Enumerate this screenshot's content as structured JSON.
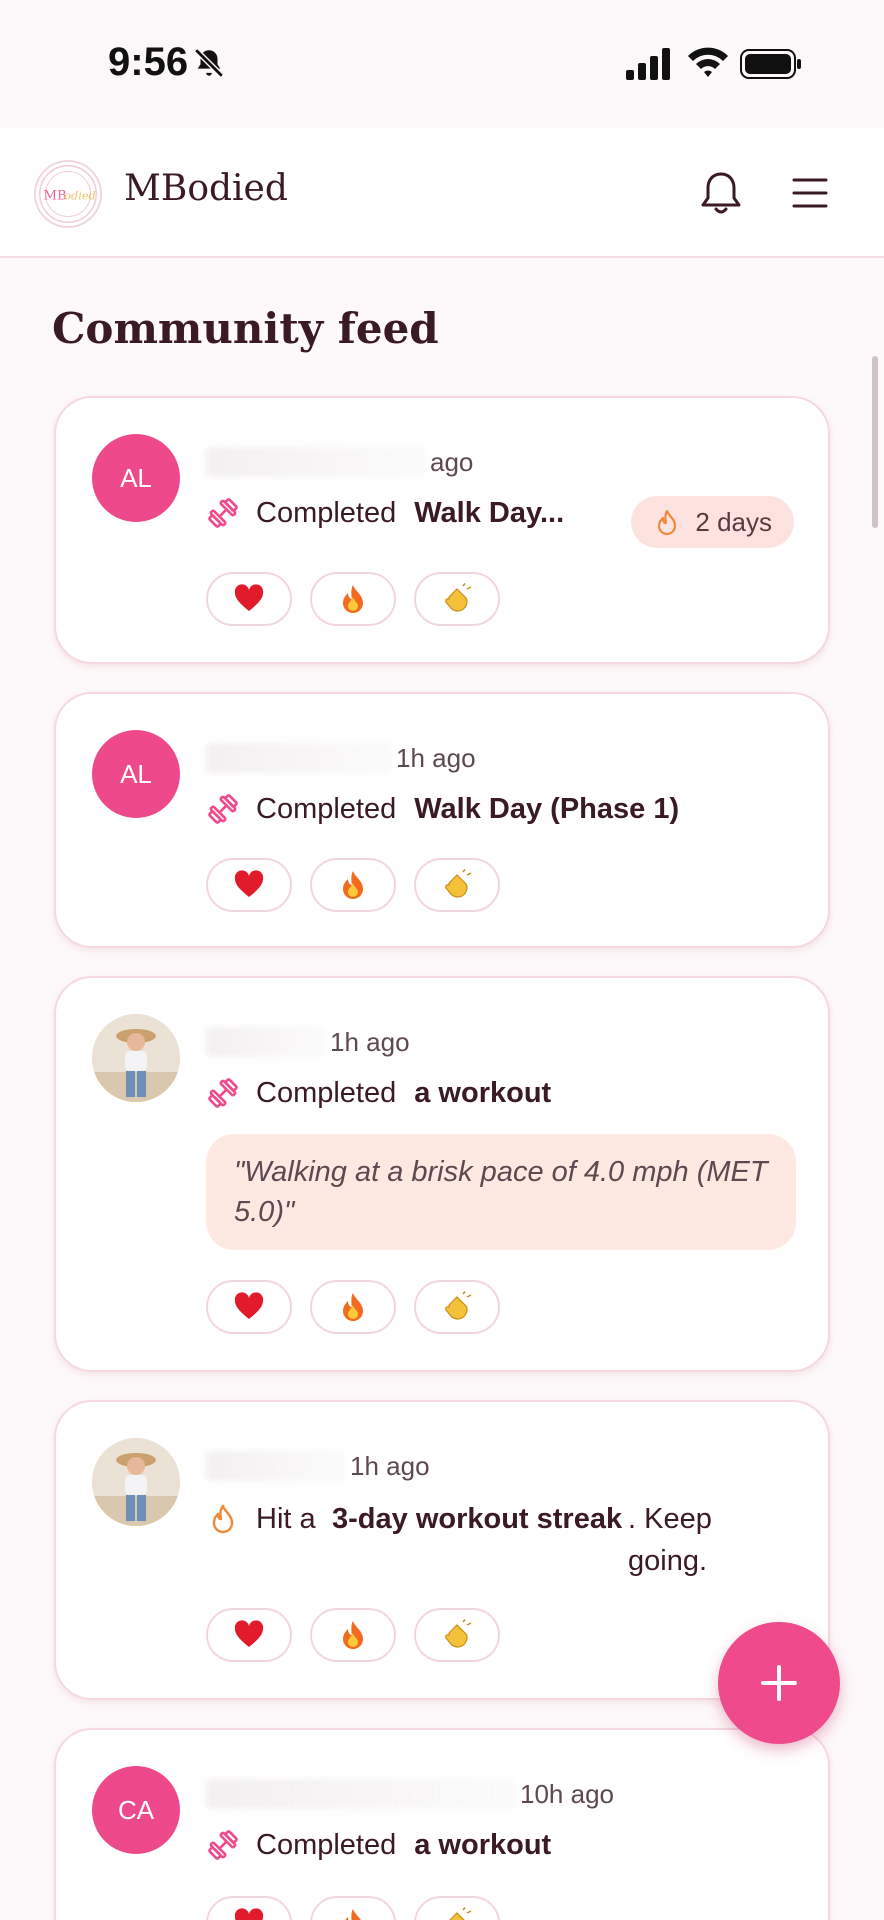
{
  "status_bar": {
    "time": "9:56"
  },
  "header": {
    "app_title": "MBodied",
    "logo_text": "MBodied"
  },
  "feed": {
    "title": "Community feed",
    "posts": [
      {
        "avatar_initials": "AL",
        "time_ago": "ago",
        "activity_label": "Completed",
        "activity_target": "Walk Day...",
        "streak_badge": "2 days"
      },
      {
        "avatar_initials": "AL",
        "time_ago": "1h ago",
        "activity_label": "Completed",
        "activity_target": "Walk Day (Phase 1)"
      },
      {
        "time_ago": "1h ago",
        "activity_label": "Completed",
        "activity_target": "a workout",
        "note": "\"Walking at a brisk pace of 4.0 mph (MET 5.0)\""
      },
      {
        "time_ago": "1h ago",
        "streak_hit": "Hit a",
        "streak_name": "3-day workout streak",
        "streak_suffix": ". Keep going."
      },
      {
        "avatar_initials": "CA",
        "time_ago": "10h ago",
        "activity_label": "Completed",
        "activity_target": "a workout"
      }
    ]
  },
  "reactions": [
    "heart",
    "fire",
    "clap"
  ],
  "colors": {
    "accent": "#ef4a8b",
    "badge_bg": "#fde3e0",
    "quote_bg": "#fde9e2",
    "card_border": "#f5d9df"
  },
  "icons": {
    "bell": "bell-icon",
    "menu": "menu-icon",
    "dumbbell": "dumbbell-icon",
    "flame": "flame-icon",
    "plus": "plus-icon"
  }
}
